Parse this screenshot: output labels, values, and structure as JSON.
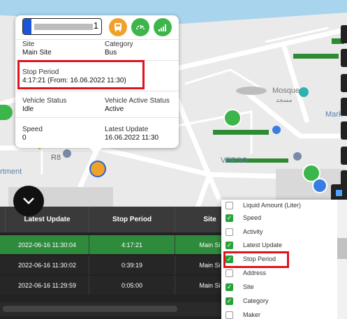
{
  "popup": {
    "plate_number_suffix": "1",
    "site_label": "Site",
    "site_value": "Main Site",
    "category_label": "Category",
    "category_value": "Bus",
    "stop_period_label": "Stop Period",
    "stop_period_value": "4:17:21 (From: 16.06.2022 11:30)",
    "vehicle_status_label": "Vehicle Status",
    "vehicle_status_value": "Idle",
    "vehicle_active_status_label": "Vehicle Active Status",
    "vehicle_active_status_value": "Active",
    "speed_label": "Speed",
    "speed_value": "0",
    "latest_update_label": "Latest Update",
    "latest_update_value": "16.06.2022 11:30",
    "icons": [
      "bus-icon",
      "speedometer-icon",
      "signal-icon"
    ],
    "colors": {
      "bus_button": "#f0a12a",
      "green_button": "#3cb64a",
      "highlight": "#e0141e"
    }
  },
  "map": {
    "labels": {
      "mosque_en": "Mosque",
      "mosque_ar": "مسجد",
      "mark": "Mark",
      "apartment": "rtment",
      "r8": "R8",
      "verso": "VERSO"
    }
  },
  "table": {
    "headers": [
      "",
      "Latest Update",
      "Stop Period",
      "Site"
    ],
    "rows": [
      {
        "latest_update": "2022-06-16 11:30:04",
        "stop_period": "4:17:21",
        "site": "Main Si"
      },
      {
        "latest_update": "2022-06-16 11:30:02",
        "stop_period": "0:39:19",
        "site": "Main Si"
      },
      {
        "latest_update": "2022-06-16 11:29:59",
        "stop_period": "0:05:00",
        "site": "Main Si"
      }
    ]
  },
  "column_chooser": {
    "items": [
      {
        "label": "Liquid Amount (Liter)",
        "checked": false
      },
      {
        "label": "Speed",
        "checked": true
      },
      {
        "label": "Activity",
        "checked": false
      },
      {
        "label": "Latest Update",
        "checked": true
      },
      {
        "label": "Stop Period",
        "checked": true
      },
      {
        "label": "Address",
        "checked": false
      },
      {
        "label": "Site",
        "checked": true
      },
      {
        "label": "Category",
        "checked": true
      },
      {
        "label": "Maker",
        "checked": false
      }
    ]
  }
}
